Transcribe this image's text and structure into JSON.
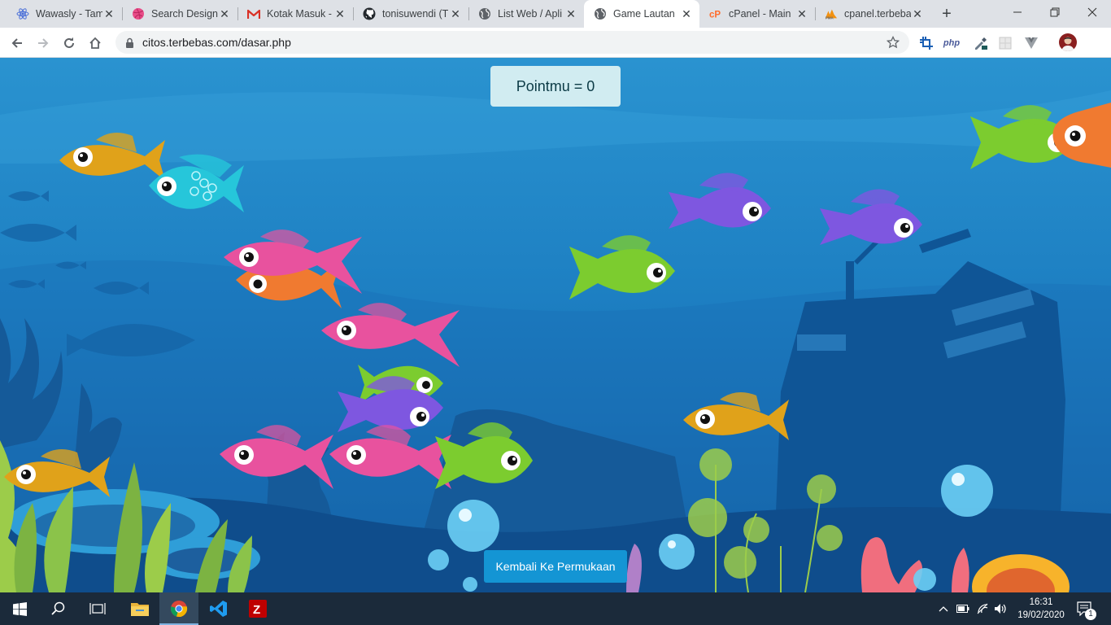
{
  "browser": {
    "tabs": [
      {
        "title": "Wawasly - Tam",
        "icon": "react-icon"
      },
      {
        "title": "Search Design",
        "icon": "dribbble-icon"
      },
      {
        "title": "Kotak Masuk -",
        "icon": "gmail-icon"
      },
      {
        "title": "tonisuwendi (T",
        "icon": "github-icon"
      },
      {
        "title": "List Web / Apli",
        "icon": "globe-icon"
      },
      {
        "title": "Game Lautan",
        "icon": "globe-icon",
        "active": true
      },
      {
        "title": "cPanel - Main",
        "icon": "cpanel-icon"
      },
      {
        "title": "cpanel.terbeba",
        "icon": "phpmyadmin-icon"
      }
    ],
    "url": "citos.terbebas.com/dasar.php",
    "extensions": [
      "crop-icon",
      "php-icon",
      "eyedropper-icon",
      "extension-icon",
      "vue-icon",
      "profile-avatar"
    ],
    "ext_php_label": "php"
  },
  "game": {
    "score_text": "Pointmu = 0",
    "back_button": "Kembali Ke Permukaan",
    "fish_colors": {
      "yellow": "#e0a21a",
      "cyan": "#26c6da",
      "pink": "#e8529e",
      "orange": "#f07a30",
      "purple": "#7e57e0",
      "green": "#7ccc2f"
    }
  },
  "taskbar": {
    "apps": [
      "start-icon",
      "search-icon",
      "task-view-icon",
      "file-explorer-icon",
      "chrome-icon",
      "vscode-icon",
      "filezilla-icon"
    ],
    "time": "16:31",
    "date": "19/02/2020",
    "notification_count": "1"
  }
}
